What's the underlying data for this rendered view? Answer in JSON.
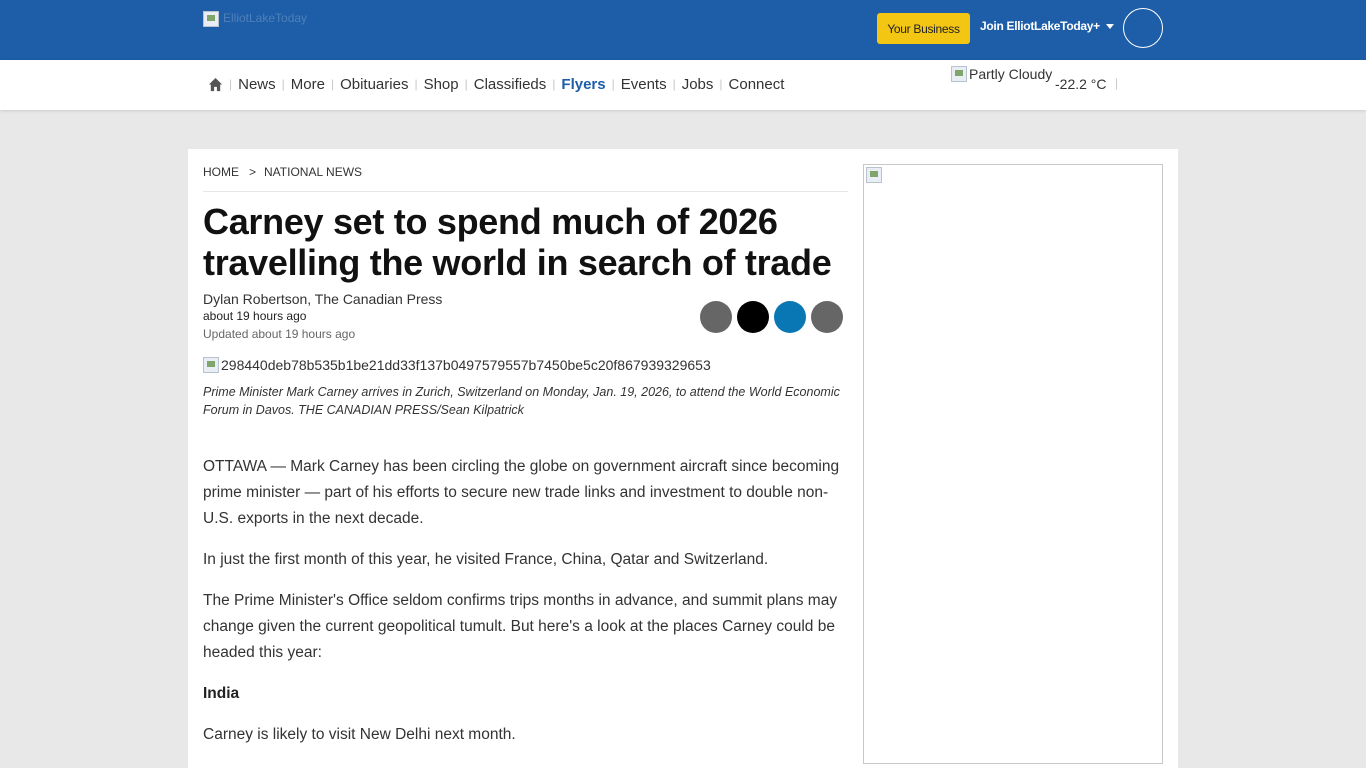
{
  "header": {
    "logo_alt": "ElliotLakeToday",
    "your_business_label": "Your Business",
    "join_label": "Join ElliotLakeToday+"
  },
  "nav": {
    "items": [
      "News",
      "More",
      "Obituaries",
      "Shop",
      "Classifieds",
      "Flyers",
      "Events",
      "Jobs",
      "Connect"
    ],
    "active": "Flyers"
  },
  "weather": {
    "icon_alt": "Partly Cloudy",
    "temperature": "-22.2 °C"
  },
  "breadcrumb": {
    "home": "HOME",
    "separator": ">",
    "section": "NATIONAL NEWS"
  },
  "article": {
    "headline": "Carney set to spend much of 2026 travelling the world in search of trade",
    "byline": "Dylan Robertson, The Canadian Press",
    "posted": "about 19 hours ago",
    "updated": "Updated about 19 hours ago",
    "image_alt": "298440deb78b535b1be21dd33f137b0497579557b7450be5c20f867939329653",
    "caption": "Prime Minister Mark Carney arrives in Zurich, Switzerland on Monday, Jan. 19, 2026, to attend the World Economic Forum in Davos. THE CANADIAN PRESS/Sean Kilpatrick",
    "paragraphs": [
      "OTTAWA — Mark Carney has been circling the globe on government aircraft since becoming prime minister — part of his efforts to secure new trade links and investment to double non-U.S. exports in the next decade.",
      "In just the first month of this year, he visited France, China, Qatar and Switzerland.",
      "The Prime Minister's Office seldom confirms trips months in advance, and summit plans may change given the current geopolitical tumult. But here's a look at the places Carney could be headed this year:",
      "India",
      "Carney is likely to visit New Delhi next month."
    ]
  },
  "share_buttons": [
    {
      "icon": "facebook-icon",
      "color": "#666666"
    },
    {
      "icon": "x-icon",
      "color": "#000000"
    },
    {
      "icon": "linkedin-icon",
      "color": "#0a77b5"
    },
    {
      "icon": "email-icon",
      "color": "#666666"
    }
  ],
  "colors": {
    "brand_blue": "#1e5ea8",
    "accent_yellow": "#f2c613",
    "page_background": "#e8e8e8"
  }
}
